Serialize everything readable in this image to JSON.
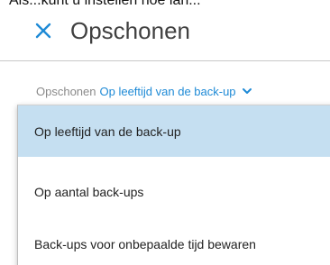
{
  "top_cut_text": "Als...kunt u instellen hoe lan...",
  "header": {
    "title": "Opschonen",
    "close_label": "×"
  },
  "filter": {
    "label": "Opschonen",
    "value": "Op leeftijd van de back-up"
  },
  "dropdown": {
    "options": [
      {
        "label": "Op leeftijd van de back-up",
        "selected": true
      },
      {
        "label": "Op aantal back-ups",
        "selected": false
      },
      {
        "label": "Back-ups voor onbepaalde tijd bewaren",
        "selected": false
      }
    ]
  },
  "colors": {
    "accent": "#1e8ad6",
    "selected_bg": "#c5dff1",
    "title": "#404040",
    "muted": "#8a8a8a"
  }
}
